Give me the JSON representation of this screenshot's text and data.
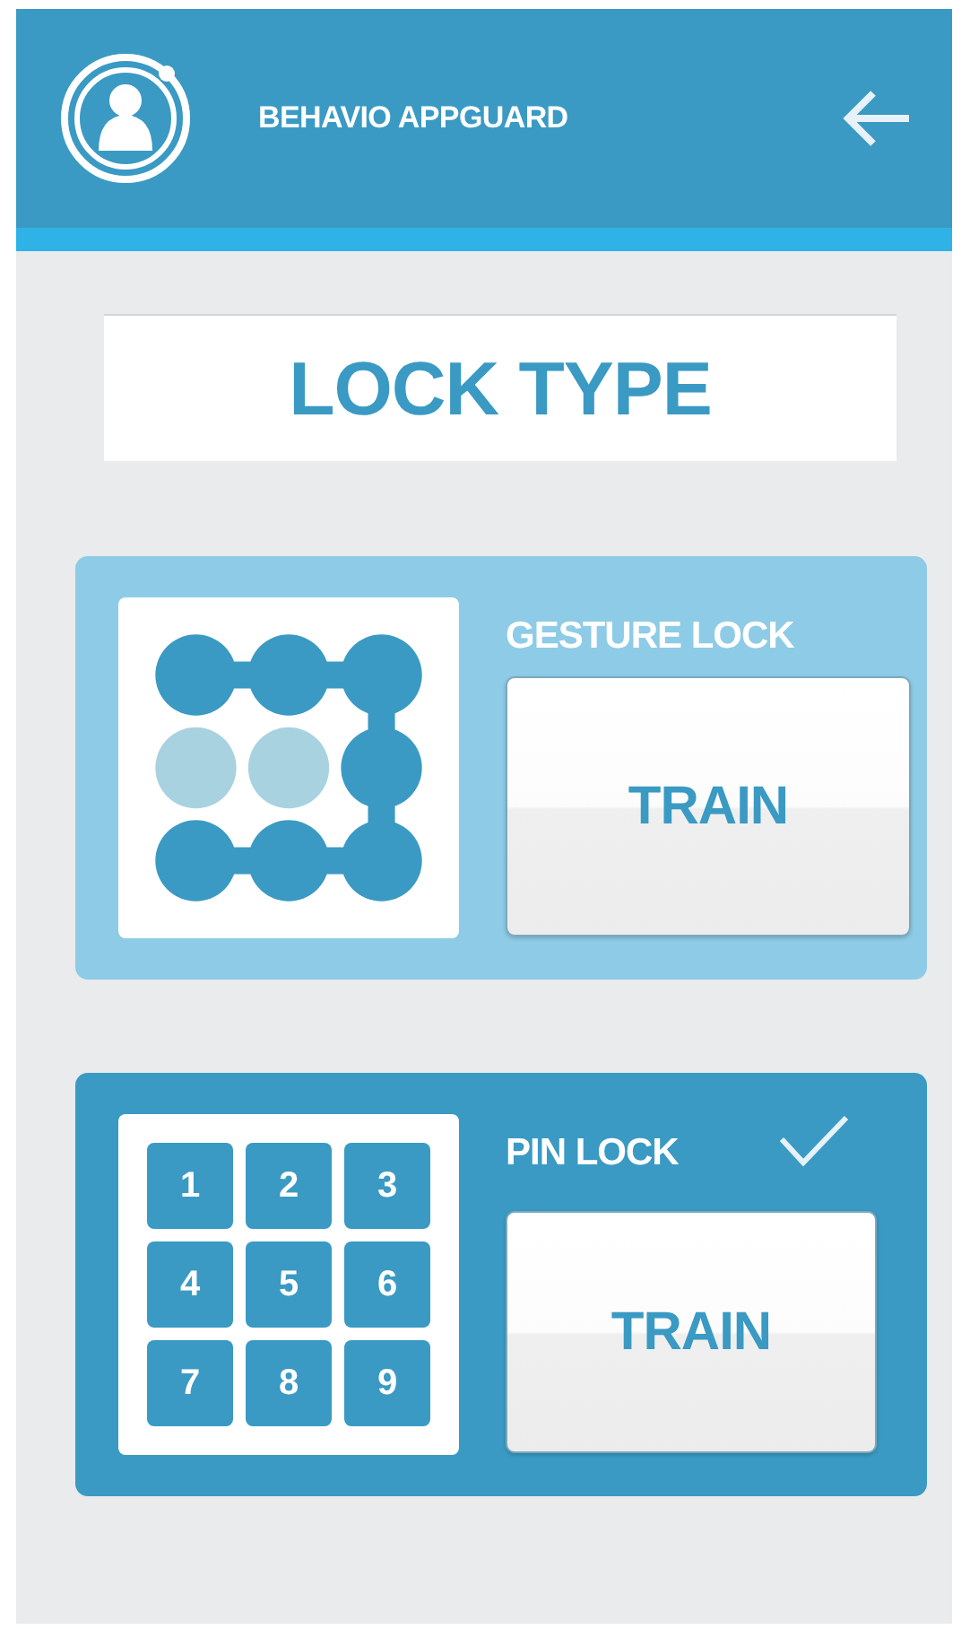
{
  "header": {
    "title": "BEHAVIO APPGUARD"
  },
  "heading": "LOCK TYPE",
  "locks": [
    {
      "kind": "gesture",
      "label": "GESTURE LOCK",
      "selected": false,
      "button": "TRAIN",
      "dots": [
        {
          "on": true
        },
        {
          "on": true
        },
        {
          "on": true
        },
        {
          "on": false
        },
        {
          "on": false
        },
        {
          "on": true
        },
        {
          "on": true
        },
        {
          "on": true
        },
        {
          "on": true
        }
      ]
    },
    {
      "kind": "pin",
      "label": "PIN LOCK",
      "selected": true,
      "button": "TRAIN",
      "keys": [
        "1",
        "2",
        "3",
        "4",
        "5",
        "6",
        "7",
        "8",
        "9"
      ]
    }
  ]
}
